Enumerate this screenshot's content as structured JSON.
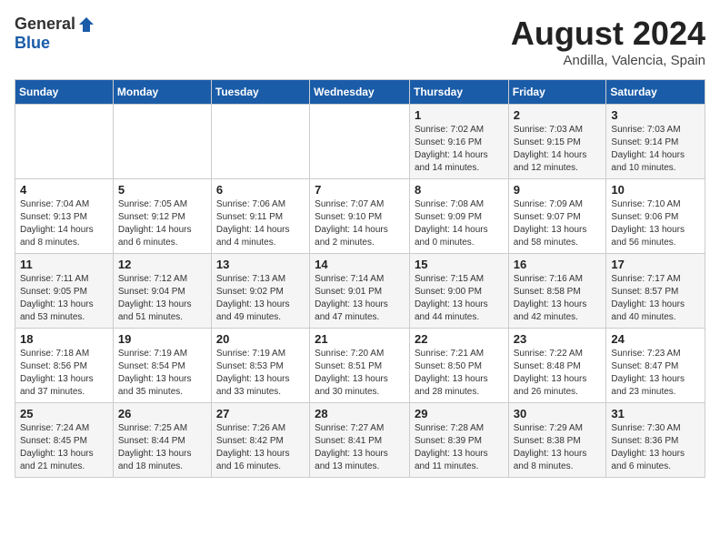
{
  "header": {
    "logo_general": "General",
    "logo_blue": "Blue",
    "month_year": "August 2024",
    "location": "Andilla, Valencia, Spain"
  },
  "calendar": {
    "weekdays": [
      "Sunday",
      "Monday",
      "Tuesday",
      "Wednesday",
      "Thursday",
      "Friday",
      "Saturday"
    ],
    "weeks": [
      [
        {
          "day": "",
          "info": ""
        },
        {
          "day": "",
          "info": ""
        },
        {
          "day": "",
          "info": ""
        },
        {
          "day": "",
          "info": ""
        },
        {
          "day": "1",
          "info": "Sunrise: 7:02 AM\nSunset: 9:16 PM\nDaylight: 14 hours\nand 14 minutes."
        },
        {
          "day": "2",
          "info": "Sunrise: 7:03 AM\nSunset: 9:15 PM\nDaylight: 14 hours\nand 12 minutes."
        },
        {
          "day": "3",
          "info": "Sunrise: 7:03 AM\nSunset: 9:14 PM\nDaylight: 14 hours\nand 10 minutes."
        }
      ],
      [
        {
          "day": "4",
          "info": "Sunrise: 7:04 AM\nSunset: 9:13 PM\nDaylight: 14 hours\nand 8 minutes."
        },
        {
          "day": "5",
          "info": "Sunrise: 7:05 AM\nSunset: 9:12 PM\nDaylight: 14 hours\nand 6 minutes."
        },
        {
          "day": "6",
          "info": "Sunrise: 7:06 AM\nSunset: 9:11 PM\nDaylight: 14 hours\nand 4 minutes."
        },
        {
          "day": "7",
          "info": "Sunrise: 7:07 AM\nSunset: 9:10 PM\nDaylight: 14 hours\nand 2 minutes."
        },
        {
          "day": "8",
          "info": "Sunrise: 7:08 AM\nSunset: 9:09 PM\nDaylight: 14 hours\nand 0 minutes."
        },
        {
          "day": "9",
          "info": "Sunrise: 7:09 AM\nSunset: 9:07 PM\nDaylight: 13 hours\nand 58 minutes."
        },
        {
          "day": "10",
          "info": "Sunrise: 7:10 AM\nSunset: 9:06 PM\nDaylight: 13 hours\nand 56 minutes."
        }
      ],
      [
        {
          "day": "11",
          "info": "Sunrise: 7:11 AM\nSunset: 9:05 PM\nDaylight: 13 hours\nand 53 minutes."
        },
        {
          "day": "12",
          "info": "Sunrise: 7:12 AM\nSunset: 9:04 PM\nDaylight: 13 hours\nand 51 minutes."
        },
        {
          "day": "13",
          "info": "Sunrise: 7:13 AM\nSunset: 9:02 PM\nDaylight: 13 hours\nand 49 minutes."
        },
        {
          "day": "14",
          "info": "Sunrise: 7:14 AM\nSunset: 9:01 PM\nDaylight: 13 hours\nand 47 minutes."
        },
        {
          "day": "15",
          "info": "Sunrise: 7:15 AM\nSunset: 9:00 PM\nDaylight: 13 hours\nand 44 minutes."
        },
        {
          "day": "16",
          "info": "Sunrise: 7:16 AM\nSunset: 8:58 PM\nDaylight: 13 hours\nand 42 minutes."
        },
        {
          "day": "17",
          "info": "Sunrise: 7:17 AM\nSunset: 8:57 PM\nDaylight: 13 hours\nand 40 minutes."
        }
      ],
      [
        {
          "day": "18",
          "info": "Sunrise: 7:18 AM\nSunset: 8:56 PM\nDaylight: 13 hours\nand 37 minutes."
        },
        {
          "day": "19",
          "info": "Sunrise: 7:19 AM\nSunset: 8:54 PM\nDaylight: 13 hours\nand 35 minutes."
        },
        {
          "day": "20",
          "info": "Sunrise: 7:19 AM\nSunset: 8:53 PM\nDaylight: 13 hours\nand 33 minutes."
        },
        {
          "day": "21",
          "info": "Sunrise: 7:20 AM\nSunset: 8:51 PM\nDaylight: 13 hours\nand 30 minutes."
        },
        {
          "day": "22",
          "info": "Sunrise: 7:21 AM\nSunset: 8:50 PM\nDaylight: 13 hours\nand 28 minutes."
        },
        {
          "day": "23",
          "info": "Sunrise: 7:22 AM\nSunset: 8:48 PM\nDaylight: 13 hours\nand 26 minutes."
        },
        {
          "day": "24",
          "info": "Sunrise: 7:23 AM\nSunset: 8:47 PM\nDaylight: 13 hours\nand 23 minutes."
        }
      ],
      [
        {
          "day": "25",
          "info": "Sunrise: 7:24 AM\nSunset: 8:45 PM\nDaylight: 13 hours\nand 21 minutes."
        },
        {
          "day": "26",
          "info": "Sunrise: 7:25 AM\nSunset: 8:44 PM\nDaylight: 13 hours\nand 18 minutes."
        },
        {
          "day": "27",
          "info": "Sunrise: 7:26 AM\nSunset: 8:42 PM\nDaylight: 13 hours\nand 16 minutes."
        },
        {
          "day": "28",
          "info": "Sunrise: 7:27 AM\nSunset: 8:41 PM\nDaylight: 13 hours\nand 13 minutes."
        },
        {
          "day": "29",
          "info": "Sunrise: 7:28 AM\nSunset: 8:39 PM\nDaylight: 13 hours\nand 11 minutes."
        },
        {
          "day": "30",
          "info": "Sunrise: 7:29 AM\nSunset: 8:38 PM\nDaylight: 13 hours\nand 8 minutes."
        },
        {
          "day": "31",
          "info": "Sunrise: 7:30 AM\nSunset: 8:36 PM\nDaylight: 13 hours\nand 6 minutes."
        }
      ]
    ]
  }
}
